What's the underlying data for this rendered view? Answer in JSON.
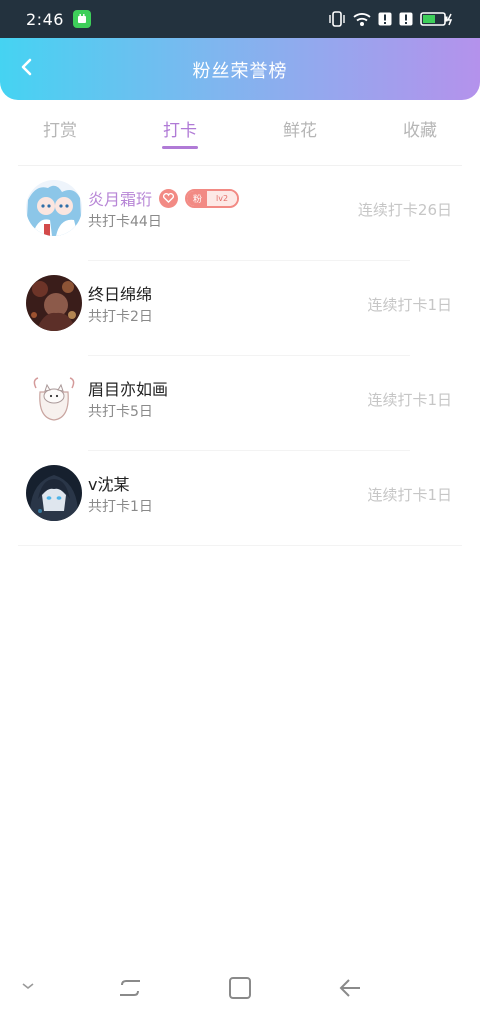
{
  "status_bar": {
    "time": "2:46",
    "icons": [
      "app-notification-icon",
      "vibrate-icon",
      "wifi-icon",
      "alert-icon",
      "alert-icon",
      "battery-charging-icon"
    ],
    "battery_level": 0.6,
    "accent": "#3ecf5a"
  },
  "header": {
    "title": "粉丝荣誉榜",
    "back_icon": "chevron-left-icon",
    "gradient": [
      "#45d3f2",
      "#b492ec"
    ]
  },
  "tabs": [
    {
      "label": "打赏",
      "active": false
    },
    {
      "label": "打卡",
      "active": true
    },
    {
      "label": "鲜花",
      "active": false
    },
    {
      "label": "收藏",
      "active": false
    }
  ],
  "tab_accent": "#b07ad6",
  "rows": [
    {
      "name": "炎月霜珩",
      "vip": true,
      "badge_heart_icon": "heart-icon",
      "fan_badge_label": "粉",
      "fan_badge_level": "lv2",
      "total": "共打卡44日",
      "streak": "连续打卡26日"
    },
    {
      "name": "终日绵绵",
      "vip": false,
      "total": "共打卡2日",
      "streak": "连续打卡1日"
    },
    {
      "name": "眉目亦如画",
      "vip": false,
      "total": "共打卡5日",
      "streak": "连续打卡1日"
    },
    {
      "name": "v沈某",
      "vip": false,
      "total": "共打卡1日",
      "streak": "连续打卡1日"
    }
  ],
  "nav_bar": {
    "icons": [
      "hide-nav-chevron-icon",
      "recents-icon",
      "home-icon",
      "back-arrow-icon"
    ]
  }
}
